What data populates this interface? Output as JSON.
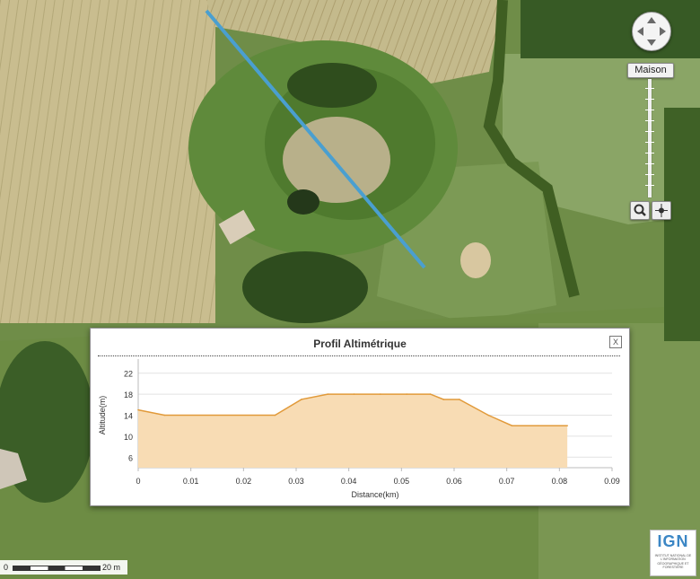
{
  "map": {
    "home_label": "Maison",
    "profile_line_color": "#4a9fd0"
  },
  "icons": {
    "pan": "pan-arrows-icon",
    "search": "magnifier-icon",
    "center": "crosshair-icon",
    "close": "close-icon"
  },
  "panel": {
    "title": "Profil Altimétrique",
    "close_label": "X"
  },
  "chart_data": {
    "type": "area",
    "title": "Profil Altimétrique",
    "xlabel": "Distance(km)",
    "ylabel": "Altitude(m)",
    "xlim": [
      0,
      0.09
    ],
    "ylim": [
      4,
      24
    ],
    "x_ticks": [
      0,
      0.01,
      0.02,
      0.03,
      0.04,
      0.05,
      0.06,
      0.07,
      0.08,
      0.09
    ],
    "x_tick_labels": [
      "0",
      "0.01",
      "0.02",
      "0.03",
      "0.04",
      "0.05",
      "0.06",
      "0.07",
      "0.08",
      "0.09"
    ],
    "y_ticks": [
      6,
      10,
      14,
      18,
      22
    ],
    "y_tick_labels": [
      "6",
      "10",
      "14",
      "18",
      "22"
    ],
    "grid": "horizontal",
    "fill_color": "#f8dcb4",
    "line_color": "#e19a3a",
    "series": [
      {
        "x": [
          0,
          0.005,
          0.026,
          0.031,
          0.036,
          0.041,
          0.046,
          0.051,
          0.0555,
          0.058,
          0.061,
          0.0665,
          0.071,
          0.076,
          0.0815
        ],
        "y": [
          15,
          14,
          14,
          17,
          18,
          18,
          18,
          18,
          18,
          17,
          17,
          14,
          12,
          12,
          12
        ]
      }
    ]
  },
  "scale": {
    "zero": "0",
    "label": "20 m"
  },
  "logo": {
    "letters": "IGN",
    "subtitle": "Institut national de l'information géographique et forestière"
  }
}
